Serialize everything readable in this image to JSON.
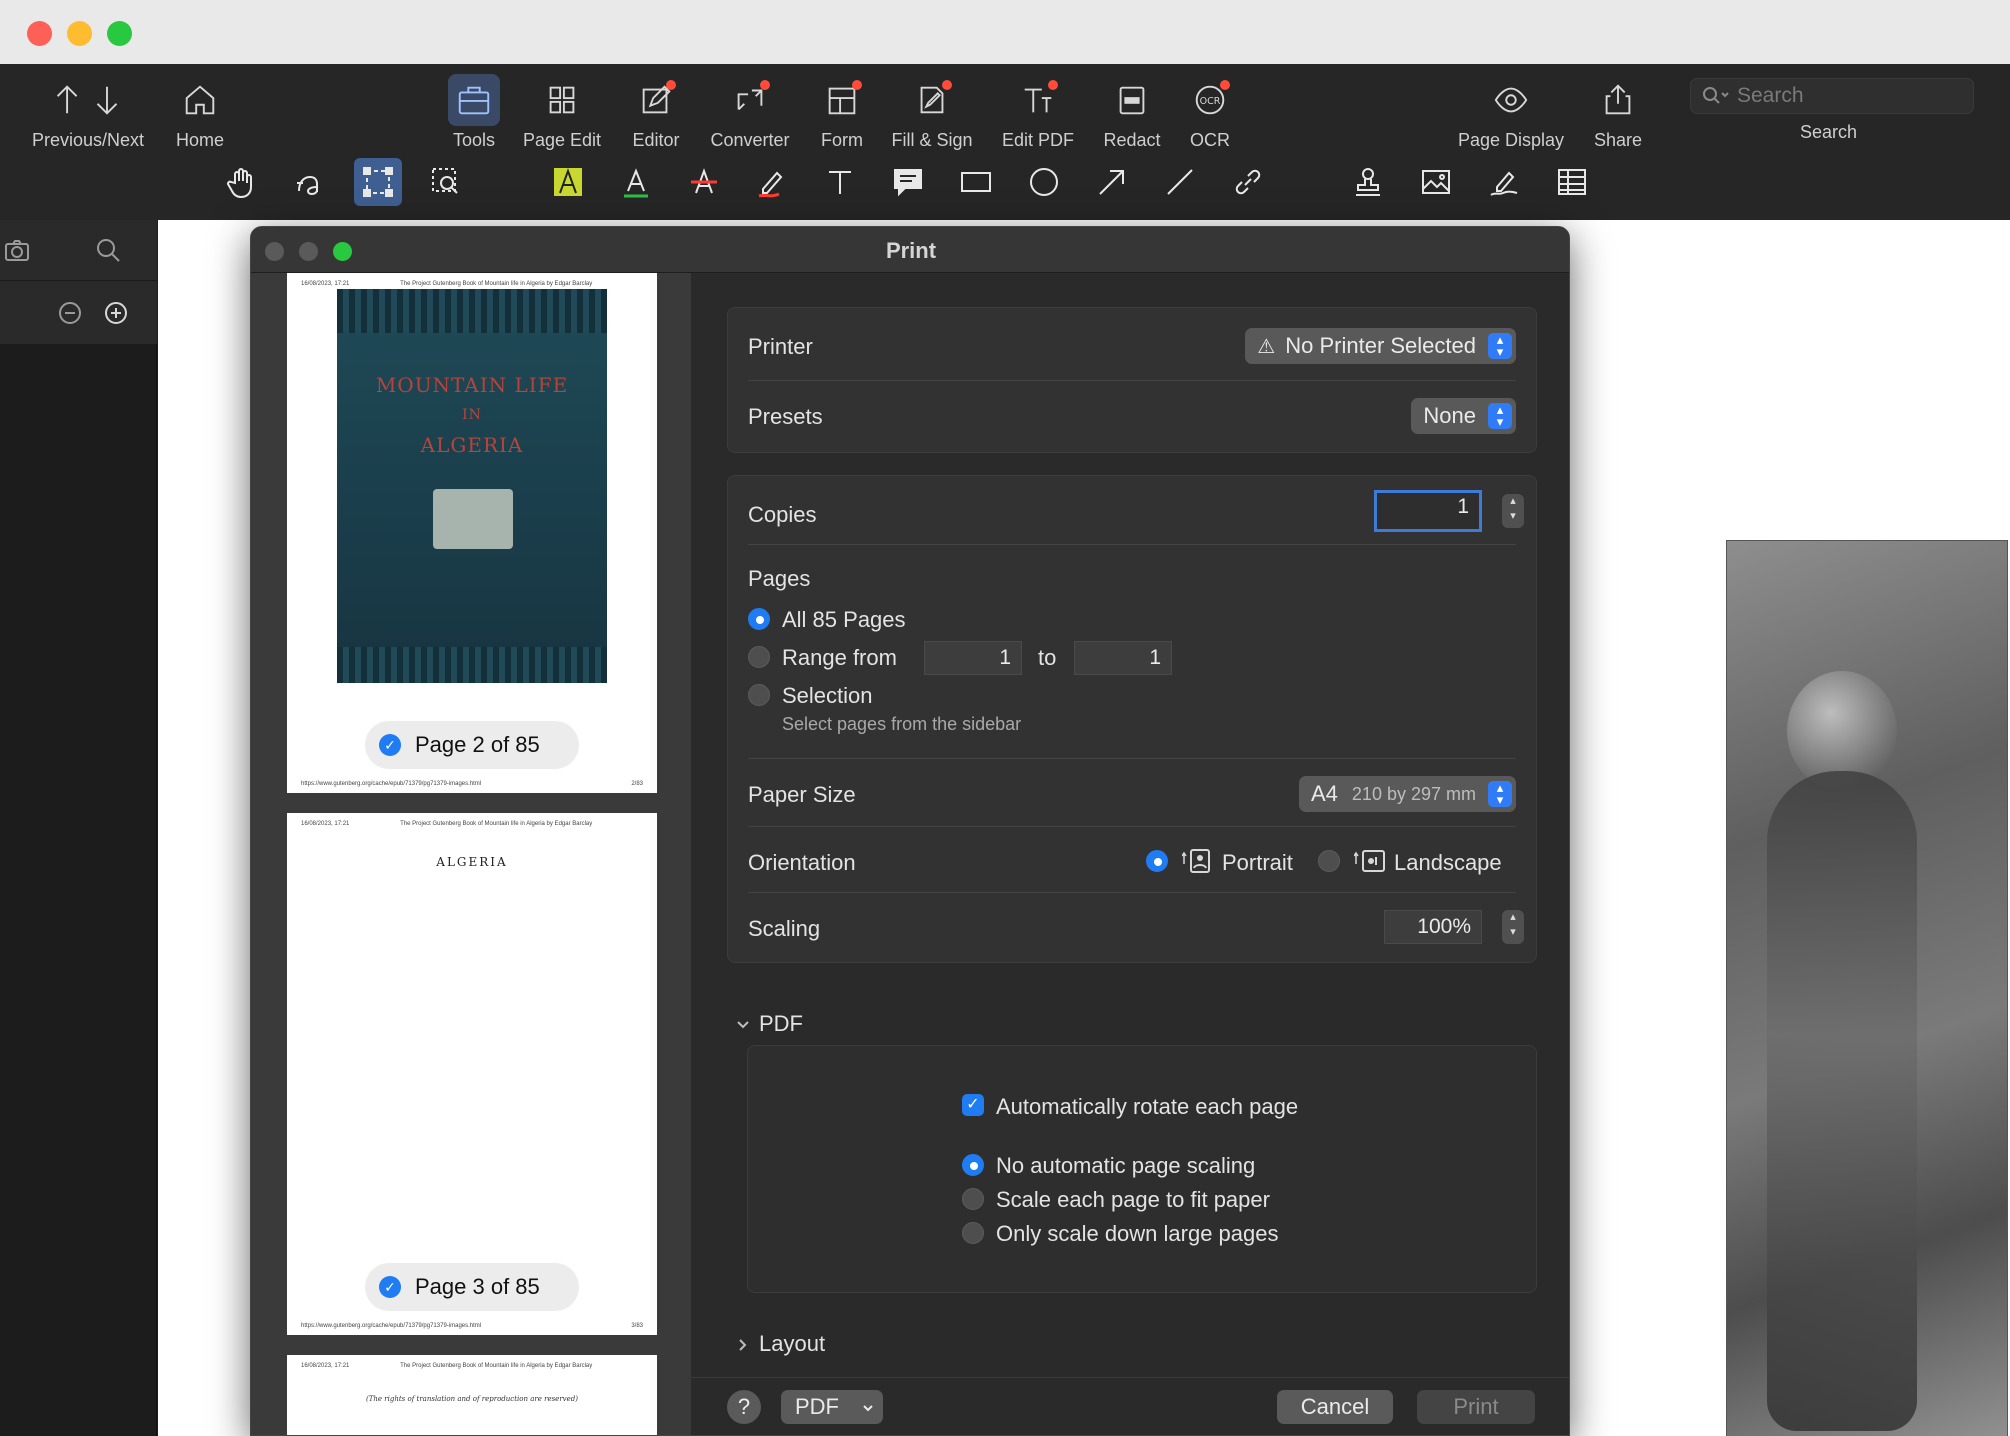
{
  "toolbar": {
    "items": [
      {
        "label": "Previous/Next",
        "icon": "arrow-up-down-icon"
      },
      {
        "label": "Home",
        "icon": "home-icon"
      },
      {
        "label": "Tools",
        "icon": "toolbox-icon"
      },
      {
        "label": "Page Edit",
        "icon": "grid-icon"
      },
      {
        "label": "Editor",
        "icon": "editor-icon"
      },
      {
        "label": "Converter",
        "icon": "converter-icon"
      },
      {
        "label": "Form",
        "icon": "form-icon"
      },
      {
        "label": "Fill & Sign",
        "icon": "fill-sign-icon"
      },
      {
        "label": "Edit PDF",
        "icon": "edit-text-icon"
      },
      {
        "label": "Redact",
        "icon": "redact-icon"
      },
      {
        "label": "OCR",
        "icon": "ocr-icon"
      },
      {
        "label": "Page Display",
        "icon": "eye-icon"
      },
      {
        "label": "Share",
        "icon": "share-icon"
      }
    ],
    "search_placeholder": "Search",
    "search_label": "Search"
  },
  "annotation_tools": [
    "hand-icon",
    "text-select-icon",
    "area-select-icon",
    "zoom-area-icon",
    "highlight-icon",
    "underline-icon",
    "strikethrough-icon",
    "pencil-icon",
    "text-icon",
    "comment-icon",
    "rectangle-icon",
    "circle-icon",
    "arrow-icon",
    "line-icon",
    "link-icon",
    "stamp-icon",
    "image-icon",
    "signature-icon",
    "table-icon"
  ],
  "dialog": {
    "title": "Print",
    "thumbnails": [
      {
        "page_label": "Page 2 of 85",
        "header_left": "16/08/2023, 17:21",
        "header_center": "The Project Gutenberg Book of Mountain life in Algeria by Edgar Barclay",
        "footer_left": "https://www.gutenberg.org/cache/epub/71379/pg71379-images.html",
        "footer_right": "2/83",
        "cover_title": [
          "MOUNTAIN LIFE",
          "IN",
          "ALGERIA"
        ]
      },
      {
        "page_label": "Page 3 of 85",
        "header_left": "16/08/2023, 17:21",
        "header_center": "The Project Gutenberg Book of Mountain life in Algeria by Edgar Barclay",
        "footer_left": "https://www.gutenberg.org/cache/epub/71379/pg71379-images.html",
        "footer_right": "3/83",
        "heading": "ALGERIA"
      },
      {
        "header_left": "16/08/2023, 17:21",
        "header_center": "The Project Gutenberg Book of Mountain life in Algeria by Edgar Barclay",
        "rights": "(The rights of translation and of reproduction are reserved)"
      }
    ],
    "printer": {
      "label": "Printer",
      "value": "No Printer Selected"
    },
    "presets": {
      "label": "Presets",
      "value": "None"
    },
    "copies": {
      "label": "Copies",
      "value": "1"
    },
    "pages": {
      "label": "Pages",
      "all": "All 85 Pages",
      "range_from": "Range from",
      "range_to": "to",
      "from_value": "1",
      "to_value": "1",
      "selection": "Selection",
      "selection_hint": "Select pages from the sidebar"
    },
    "paper_size": {
      "label": "Paper Size",
      "value": "A4",
      "detail": "210 by 297 mm"
    },
    "orientation": {
      "label": "Orientation",
      "portrait": "Portrait",
      "landscape": "Landscape"
    },
    "scaling": {
      "label": "Scaling",
      "value": "100%"
    },
    "pdf_section": {
      "label": "PDF",
      "auto_rotate": "Automatically rotate each page",
      "no_scaling": "No automatic page scaling",
      "fit_paper": "Scale each page to fit paper",
      "scale_down": "Only scale down large pages"
    },
    "layout_section": {
      "label": "Layout"
    },
    "footer": {
      "help": "?",
      "pdf_button": "PDF",
      "cancel": "Cancel",
      "print": "Print"
    }
  }
}
